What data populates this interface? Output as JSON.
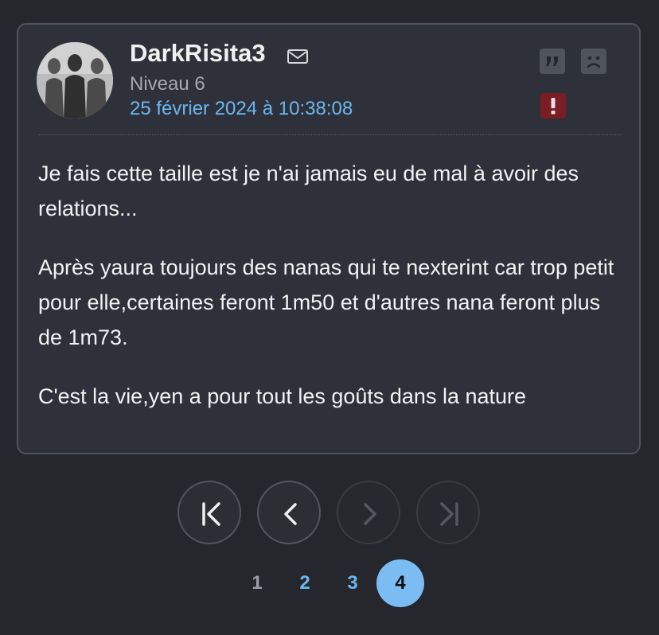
{
  "post": {
    "author": {
      "name": "DarkRisita3",
      "level": "Niveau 6",
      "avatar_icon": "avatar-group-silhouettes"
    },
    "date": "25 février 2024 à 10:38:08",
    "icons": {
      "message": "mail-icon",
      "quote": "quote-icon",
      "reaction": "sad-face-icon",
      "report": "exclamation-icon"
    },
    "paragraphs": [
      "Je fais cette taille est je n'ai jamais eu de mal à avoir des relations...",
      "Après yaura toujours des nanas qui te nexterint car trop petit pour elle,certaines feront 1m50 et d'autres nana feront plus de 1m73.",
      "C'est la vie,yen a pour tout les goûts dans la nature"
    ]
  },
  "pagination": {
    "buttons": [
      "first-page-icon",
      "previous-page-icon",
      "next-page-icon",
      "last-page-icon"
    ],
    "pages": [
      "1",
      "2",
      "3",
      "4"
    ],
    "current": "4"
  },
  "colors": {
    "background": "#25272c",
    "card": "#2e3139",
    "link": "#6bb6f2",
    "report": "#7a1d25",
    "current_page": "#7bbdf3"
  }
}
